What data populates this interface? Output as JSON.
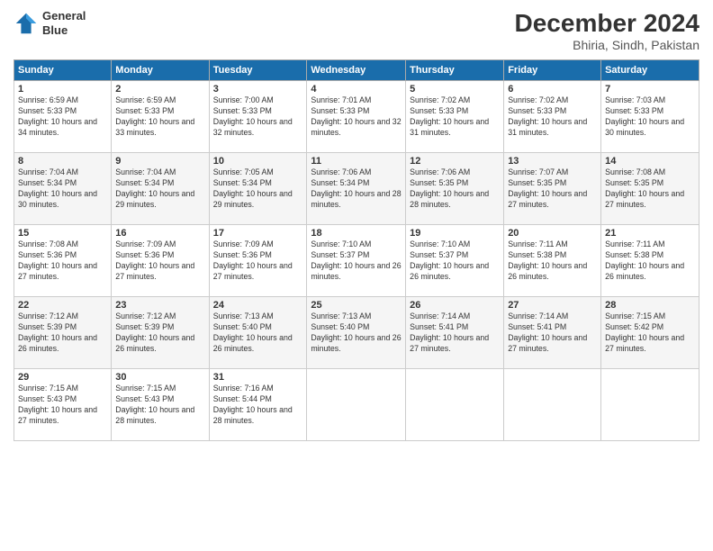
{
  "header": {
    "logo_line1": "General",
    "logo_line2": "Blue",
    "month": "December 2024",
    "location": "Bhiria, Sindh, Pakistan"
  },
  "weekdays": [
    "Sunday",
    "Monday",
    "Tuesday",
    "Wednesday",
    "Thursday",
    "Friday",
    "Saturday"
  ],
  "weeks": [
    [
      {
        "day": "1",
        "sunrise": "6:59 AM",
        "sunset": "5:33 PM",
        "daylight": "10 hours and 34 minutes."
      },
      {
        "day": "2",
        "sunrise": "6:59 AM",
        "sunset": "5:33 PM",
        "daylight": "10 hours and 33 minutes."
      },
      {
        "day": "3",
        "sunrise": "7:00 AM",
        "sunset": "5:33 PM",
        "daylight": "10 hours and 32 minutes."
      },
      {
        "day": "4",
        "sunrise": "7:01 AM",
        "sunset": "5:33 PM",
        "daylight": "10 hours and 32 minutes."
      },
      {
        "day": "5",
        "sunrise": "7:02 AM",
        "sunset": "5:33 PM",
        "daylight": "10 hours and 31 minutes."
      },
      {
        "day": "6",
        "sunrise": "7:02 AM",
        "sunset": "5:33 PM",
        "daylight": "10 hours and 31 minutes."
      },
      {
        "day": "7",
        "sunrise": "7:03 AM",
        "sunset": "5:33 PM",
        "daylight": "10 hours and 30 minutes."
      }
    ],
    [
      {
        "day": "8",
        "sunrise": "7:04 AM",
        "sunset": "5:34 PM",
        "daylight": "10 hours and 30 minutes."
      },
      {
        "day": "9",
        "sunrise": "7:04 AM",
        "sunset": "5:34 PM",
        "daylight": "10 hours and 29 minutes."
      },
      {
        "day": "10",
        "sunrise": "7:05 AM",
        "sunset": "5:34 PM",
        "daylight": "10 hours and 29 minutes."
      },
      {
        "day": "11",
        "sunrise": "7:06 AM",
        "sunset": "5:34 PM",
        "daylight": "10 hours and 28 minutes."
      },
      {
        "day": "12",
        "sunrise": "7:06 AM",
        "sunset": "5:35 PM",
        "daylight": "10 hours and 28 minutes."
      },
      {
        "day": "13",
        "sunrise": "7:07 AM",
        "sunset": "5:35 PM",
        "daylight": "10 hours and 27 minutes."
      },
      {
        "day": "14",
        "sunrise": "7:08 AM",
        "sunset": "5:35 PM",
        "daylight": "10 hours and 27 minutes."
      }
    ],
    [
      {
        "day": "15",
        "sunrise": "7:08 AM",
        "sunset": "5:36 PM",
        "daylight": "10 hours and 27 minutes."
      },
      {
        "day": "16",
        "sunrise": "7:09 AM",
        "sunset": "5:36 PM",
        "daylight": "10 hours and 27 minutes."
      },
      {
        "day": "17",
        "sunrise": "7:09 AM",
        "sunset": "5:36 PM",
        "daylight": "10 hours and 27 minutes."
      },
      {
        "day": "18",
        "sunrise": "7:10 AM",
        "sunset": "5:37 PM",
        "daylight": "10 hours and 26 minutes."
      },
      {
        "day": "19",
        "sunrise": "7:10 AM",
        "sunset": "5:37 PM",
        "daylight": "10 hours and 26 minutes."
      },
      {
        "day": "20",
        "sunrise": "7:11 AM",
        "sunset": "5:38 PM",
        "daylight": "10 hours and 26 minutes."
      },
      {
        "day": "21",
        "sunrise": "7:11 AM",
        "sunset": "5:38 PM",
        "daylight": "10 hours and 26 minutes."
      }
    ],
    [
      {
        "day": "22",
        "sunrise": "7:12 AM",
        "sunset": "5:39 PM",
        "daylight": "10 hours and 26 minutes."
      },
      {
        "day": "23",
        "sunrise": "7:12 AM",
        "sunset": "5:39 PM",
        "daylight": "10 hours and 26 minutes."
      },
      {
        "day": "24",
        "sunrise": "7:13 AM",
        "sunset": "5:40 PM",
        "daylight": "10 hours and 26 minutes."
      },
      {
        "day": "25",
        "sunrise": "7:13 AM",
        "sunset": "5:40 PM",
        "daylight": "10 hours and 26 minutes."
      },
      {
        "day": "26",
        "sunrise": "7:14 AM",
        "sunset": "5:41 PM",
        "daylight": "10 hours and 27 minutes."
      },
      {
        "day": "27",
        "sunrise": "7:14 AM",
        "sunset": "5:41 PM",
        "daylight": "10 hours and 27 minutes."
      },
      {
        "day": "28",
        "sunrise": "7:15 AM",
        "sunset": "5:42 PM",
        "daylight": "10 hours and 27 minutes."
      }
    ],
    [
      {
        "day": "29",
        "sunrise": "7:15 AM",
        "sunset": "5:43 PM",
        "daylight": "10 hours and 27 minutes."
      },
      {
        "day": "30",
        "sunrise": "7:15 AM",
        "sunset": "5:43 PM",
        "daylight": "10 hours and 28 minutes."
      },
      {
        "day": "31",
        "sunrise": "7:16 AM",
        "sunset": "5:44 PM",
        "daylight": "10 hours and 28 minutes."
      },
      null,
      null,
      null,
      null
    ]
  ]
}
